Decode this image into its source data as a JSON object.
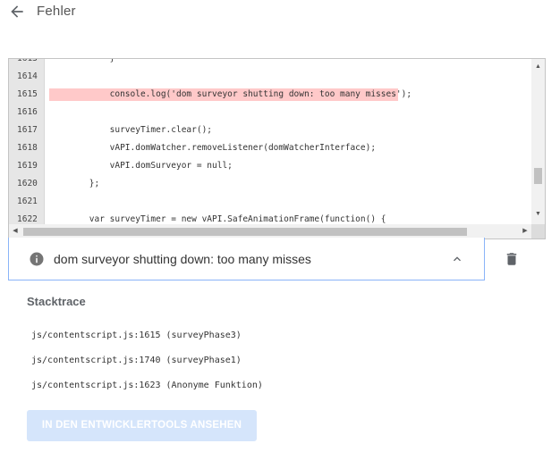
{
  "header": {
    "title": "Fehler",
    "back_icon": "arrow-left-icon"
  },
  "code": {
    "lines": [
      {
        "number": "1613",
        "text": "            }"
      },
      {
        "number": "1614",
        "text": ""
      },
      {
        "number": "1615",
        "text": "            console.log('dom surveyor shutting down: too many misses');",
        "highlight": true
      },
      {
        "number": "1616",
        "text": ""
      },
      {
        "number": "1617",
        "text": "            surveyTimer.clear();"
      },
      {
        "number": "1618",
        "text": "            vAPI.domWatcher.removeListener(domWatcherInterface);"
      },
      {
        "number": "1619",
        "text": "            vAPI.domSurveyor = null;"
      },
      {
        "number": "1620",
        "text": "        };"
      },
      {
        "number": "1621",
        "text": ""
      },
      {
        "number": "1622",
        "text": "        var surveyTimer = new vAPI.SafeAnimationFrame(function() {"
      }
    ],
    "highlight_color": "#ffc9c9"
  },
  "message": {
    "text": "dom surveyor shutting down: too many misses",
    "icon": "info-icon"
  },
  "stacktrace": {
    "title": "Stacktrace",
    "frames": [
      "js/contentscript.js:1615 (surveyPhase3)",
      "js/contentscript.js:1740 (surveyPhase1)",
      "js/contentscript.js:1623 (Anonyme Funktion)"
    ]
  },
  "actions": {
    "devtools_button": "IN DEN ENTWICKLERTOOLS ANSEHEN",
    "delete_icon": "trash-icon"
  },
  "colors": {
    "accent_border": "#8ab4f8",
    "button_bg": "#d5e5fb",
    "gutter_bg": "#e6e6e6"
  }
}
